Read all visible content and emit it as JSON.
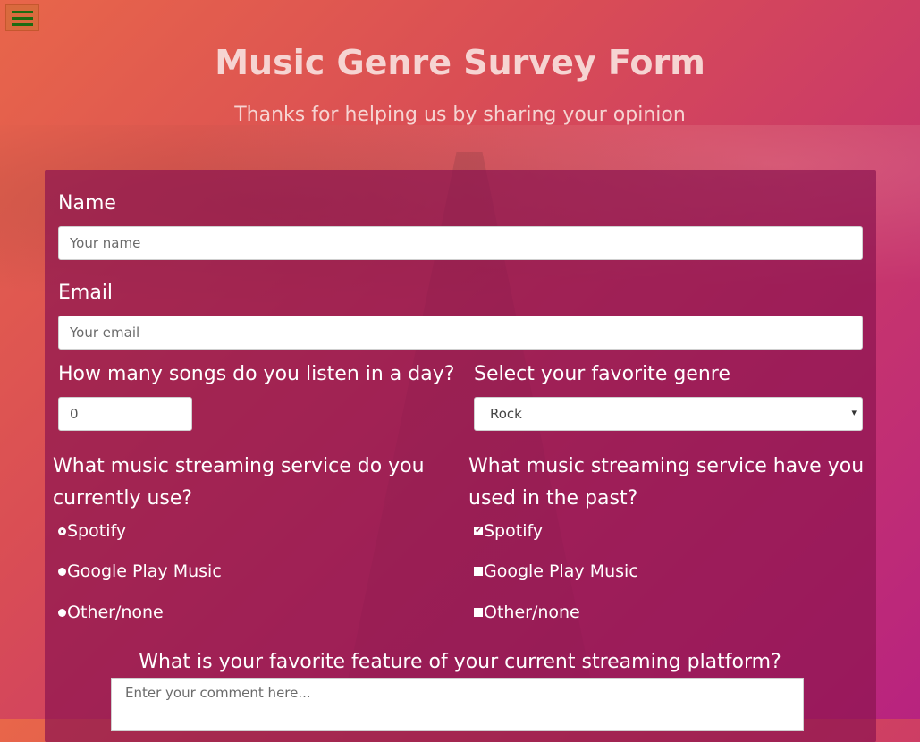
{
  "header": {
    "title": "Music Genre Survey Form",
    "subtitle": "Thanks for helping us by sharing your opinion"
  },
  "menu": {
    "icon": "hamburger-menu-icon"
  },
  "form": {
    "name": {
      "label": "Name",
      "placeholder": "Your name"
    },
    "email": {
      "label": "Email",
      "placeholder": "Your email"
    },
    "songs": {
      "label": "How many songs do you listen in a day?",
      "value": "0"
    },
    "genre": {
      "label": "Select your favorite genre",
      "selected": "Rock",
      "arrow": "▾"
    },
    "current_service": {
      "label_line1": "What music streaming service do you",
      "label_line2": "currently use?",
      "options": [
        {
          "label": "Spotify",
          "checked": true
        },
        {
          "label": "Google Play Music",
          "checked": false
        },
        {
          "label": "Other/none",
          "checked": false
        }
      ]
    },
    "past_service": {
      "label_line1": "What music streaming service have you",
      "label_line2": "used in the past?",
      "options": [
        {
          "label": "Spotify",
          "checked": true
        },
        {
          "label": "Google Play Music",
          "checked": false
        },
        {
          "label": "Other/none",
          "checked": false
        }
      ]
    },
    "feature": {
      "label": "What is your favorite feature of your current streaming platform?",
      "placeholder": "Enter your comment here..."
    }
  },
  "colors": {
    "panel": "#8c1450",
    "menu_bg": "#d96a3e",
    "menu_bars": "#1d6b12"
  }
}
